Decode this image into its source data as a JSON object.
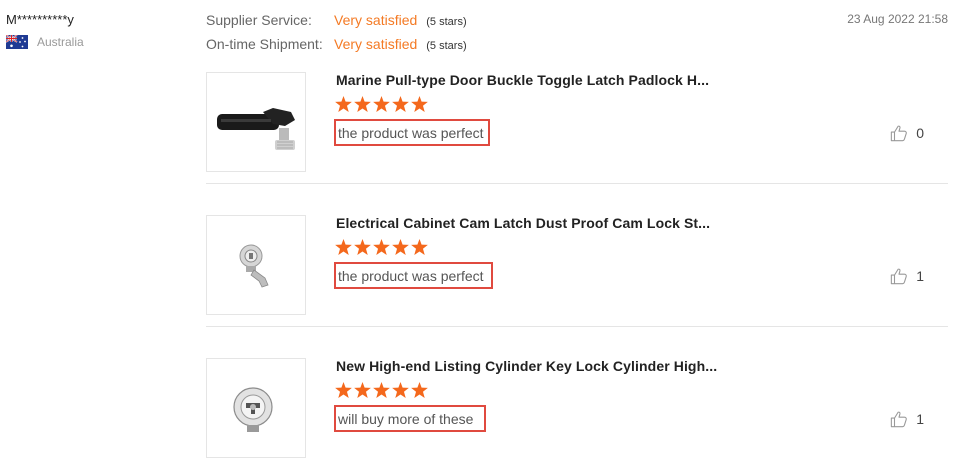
{
  "reviewer": {
    "name": "M**********y",
    "country": "Australia",
    "flag_icon": "australia-flag-icon"
  },
  "ratings": [
    {
      "label": "Supplier Service:",
      "value": "Very satisfied",
      "stars_text": "(5 stars)"
    },
    {
      "label": "On-time Shipment:",
      "value": "Very satisfied",
      "stars_text": "(5 stars)"
    }
  ],
  "date": "23 Aug 2022 21:58",
  "colors": {
    "accent": "#f47a24",
    "star": "#f4681c",
    "highlight_box": "#e04a3f"
  },
  "products": [
    {
      "title": "Marine Pull-type Door Buckle Toggle Latch Padlock H...",
      "rating": 5,
      "comment": "the product was perfect",
      "likes": "0",
      "image_icon": "toggle-latch-image"
    },
    {
      "title": "Electrical Cabinet Cam Latch Dust Proof Cam Lock St...",
      "rating": 5,
      "comment": "the product was perfect",
      "likes": "1",
      "image_icon": "cam-lock-image"
    },
    {
      "title": "New High-end Listing Cylinder Key Lock Cylinder High...",
      "rating": 5,
      "comment": "will buy more of these",
      "likes": "1",
      "image_icon": "cylinder-lock-image"
    }
  ]
}
